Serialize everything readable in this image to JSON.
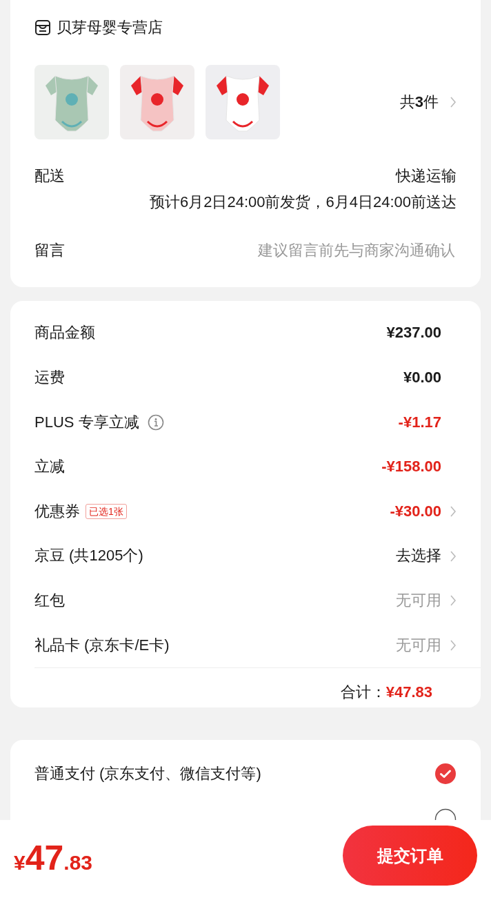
{
  "store": {
    "name": "贝芽母婴专营店"
  },
  "product_count": "共**3**件",
  "delivery": {
    "label": "配送",
    "method": "快递运输",
    "estimate": "预计6月2日24:00前发货，6月4日24:00前送达"
  },
  "message": {
    "label": "留言",
    "placeholder": "建议留言前先与商家沟通确认"
  },
  "summary": [
    {
      "label": "商品金额",
      "value": "¥237.00",
      "kind": "amount",
      "chevron": false
    },
    {
      "label": "运费",
      "value": "¥0.00",
      "kind": "amount",
      "chevron": false
    },
    {
      "label": "PLUS 专享立减",
      "value": "-¥1.17",
      "kind": "discount",
      "chevron": false,
      "info": true
    },
    {
      "label": "立减",
      "value": "-¥158.00",
      "kind": "discount",
      "chevron": false
    },
    {
      "label": "优惠券",
      "tag": "已选1张",
      "value": "-¥30.00",
      "kind": "discount",
      "chevron": true
    },
    {
      "label": "京豆 (共1205个)",
      "value": "去选择",
      "kind": "action",
      "chevron": true
    },
    {
      "label": "红包",
      "value": "无可用",
      "kind": "muted",
      "chevron": true
    },
    {
      "label": "礼品卡 (京东卡/E卡)",
      "value": "无可用",
      "kind": "muted",
      "chevron": true
    }
  ],
  "total": {
    "label": "合计：",
    "value": "¥47.83"
  },
  "payment": [
    {
      "label": "普通支付 (京东支付、微信支付等)",
      "selected": true
    },
    {
      "selected": false
    }
  ],
  "footer": {
    "currency": "¥",
    "integer": "47",
    "decimal": ".83",
    "button": "提交订单"
  }
}
